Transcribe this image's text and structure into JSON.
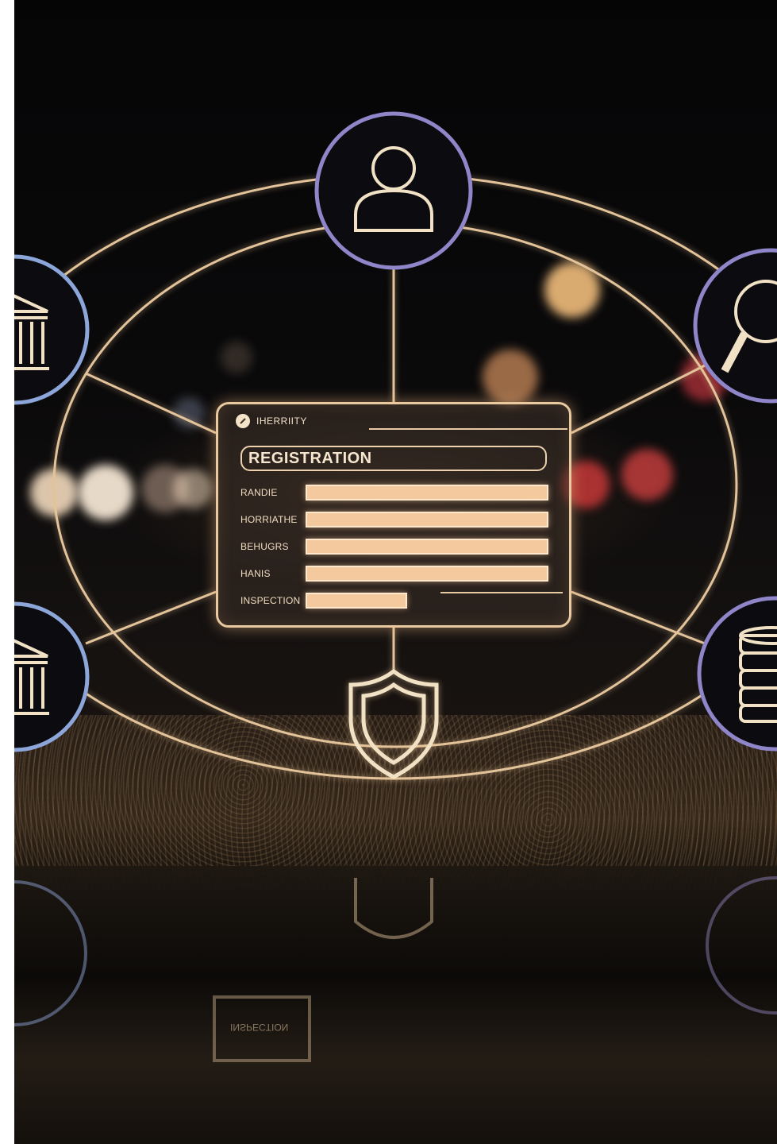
{
  "form": {
    "header": "IHERRIITY",
    "title": "REGISTRATION",
    "fields": [
      {
        "label": "RANDIE"
      },
      {
        "label": "HORRIATHE"
      },
      {
        "label": "BEHUGRS"
      },
      {
        "label": "HANIS"
      },
      {
        "label": "INSPECTION"
      }
    ]
  },
  "icons": [
    "user-icon",
    "bank-icon",
    "search-icon",
    "bank-icon",
    "coins-icon",
    "shield-icon"
  ],
  "colors": {
    "line": "#e3c39a",
    "ring": "#8f86c9",
    "panel_border": "#e9c9a0",
    "field_fill": "#f3c99d"
  },
  "reflection_text": "INSPECTION"
}
